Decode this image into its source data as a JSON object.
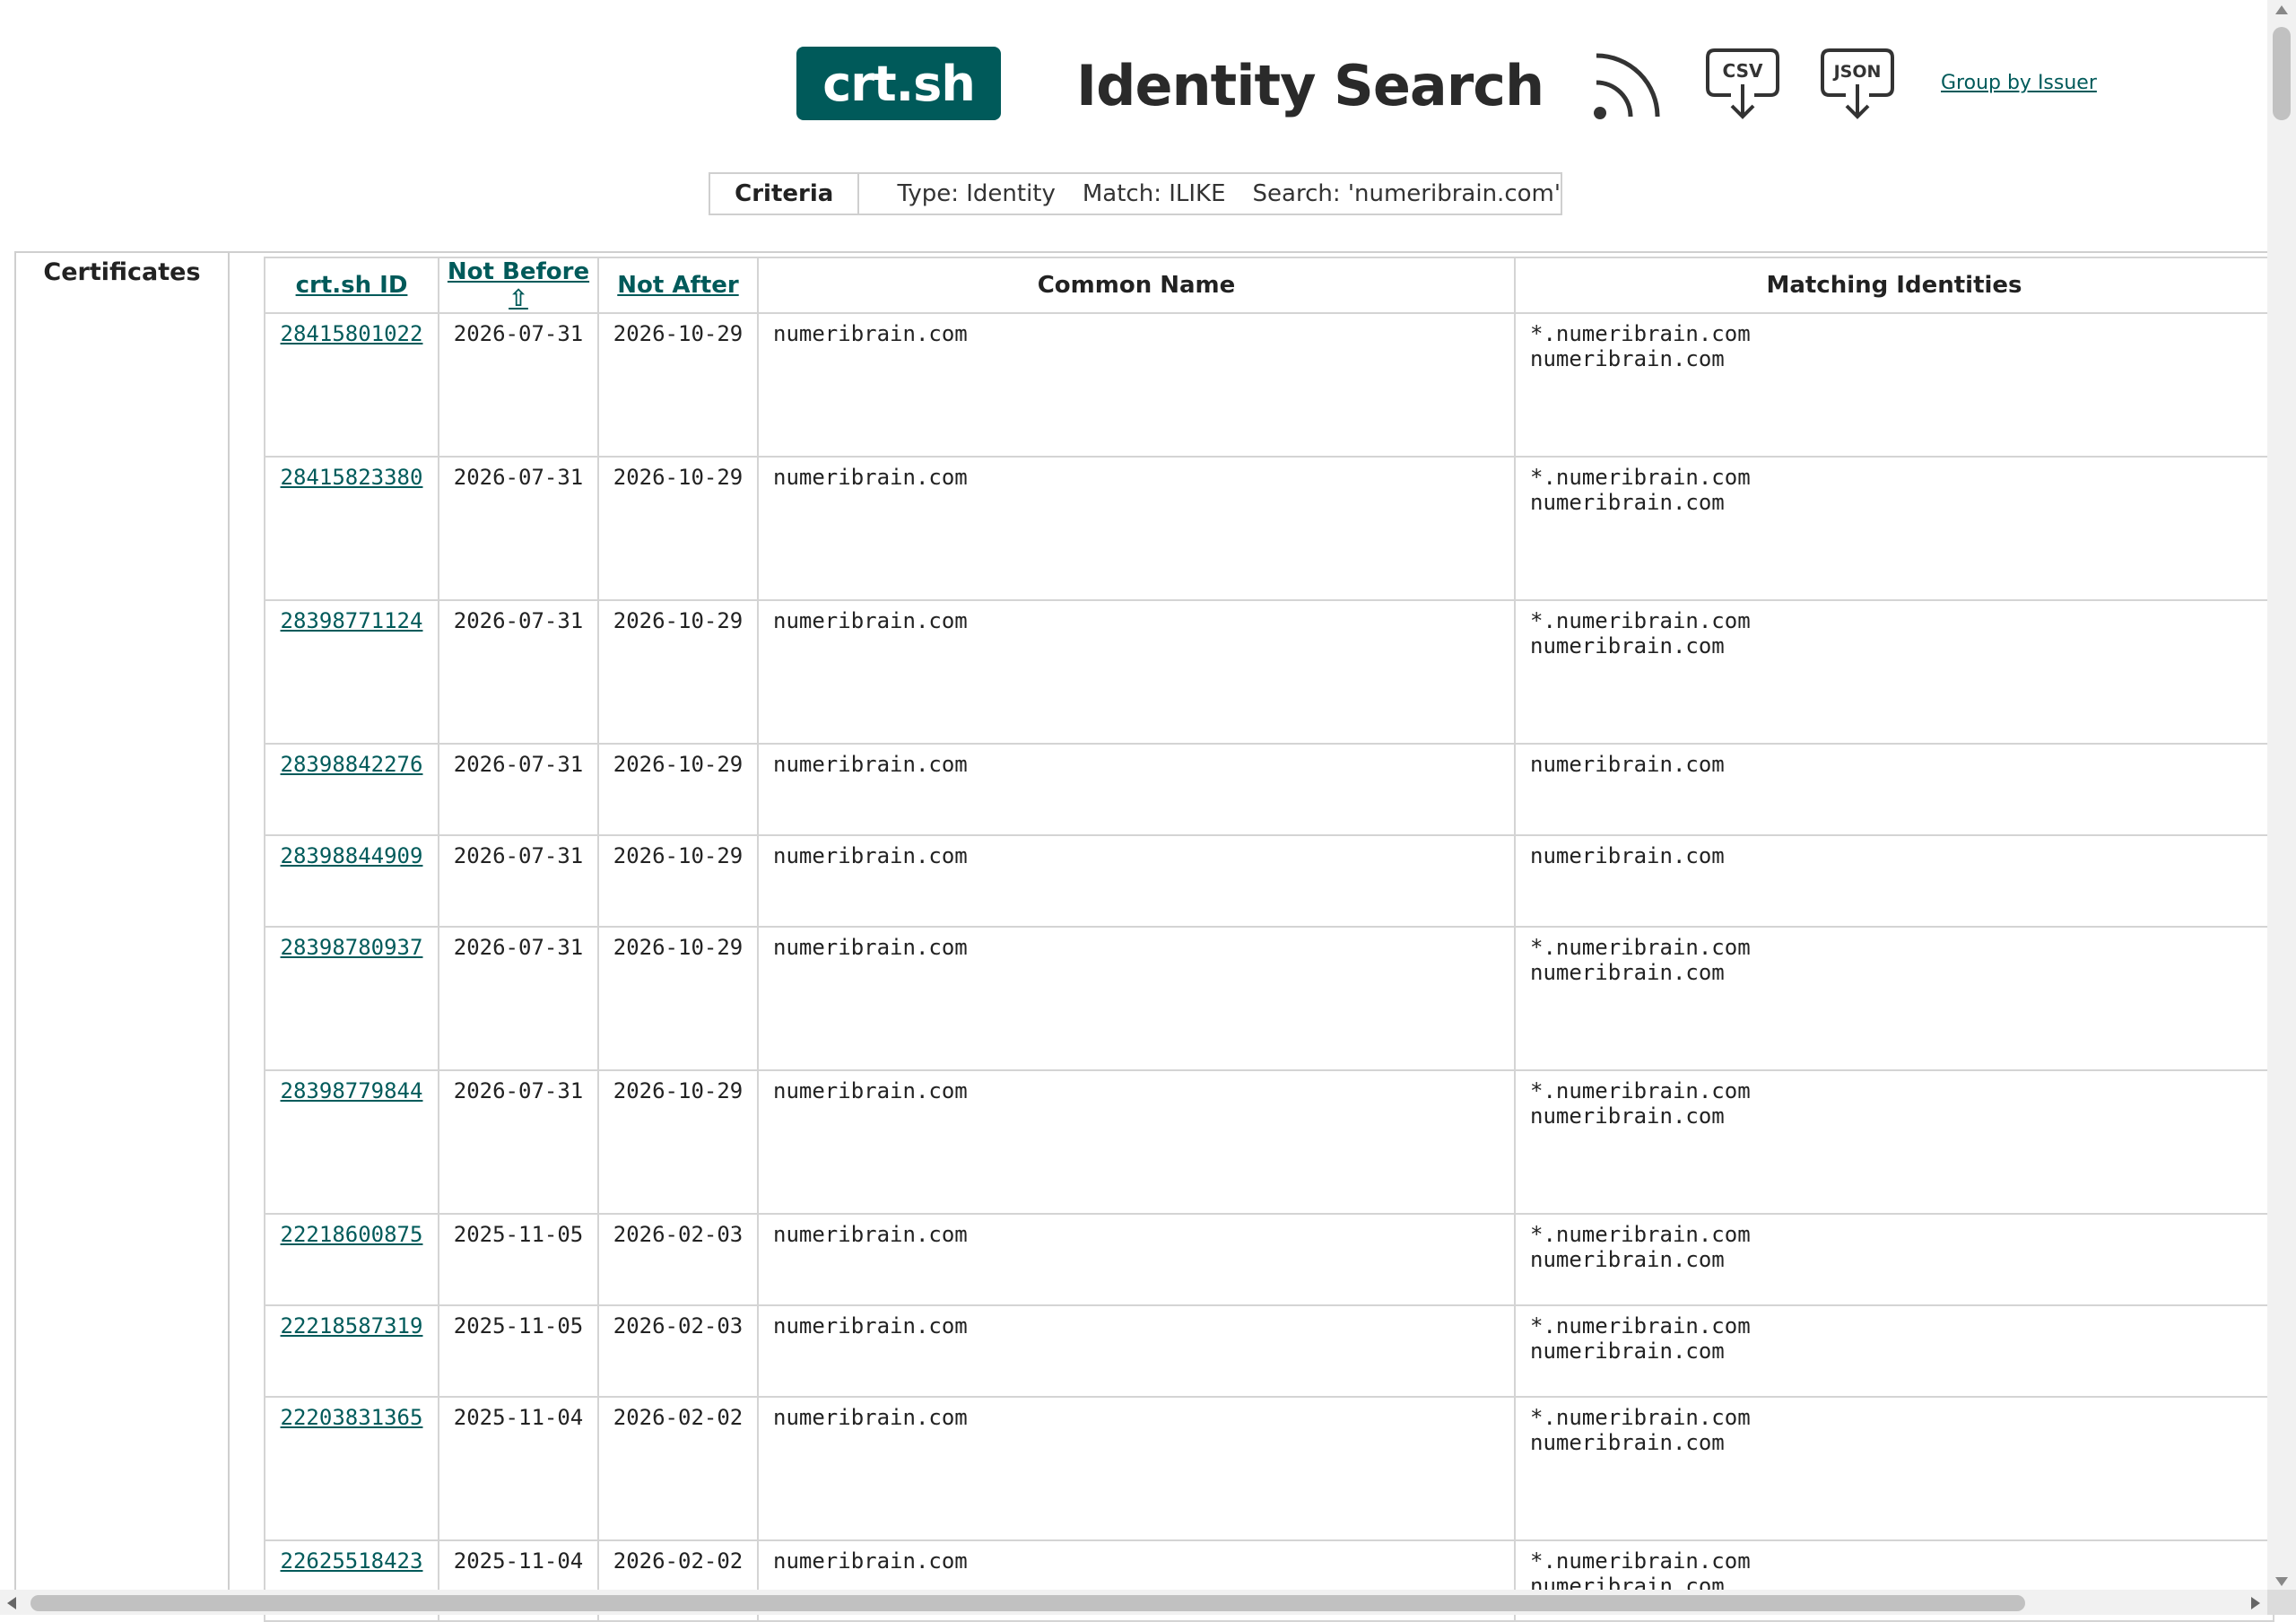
{
  "header": {
    "logo_text": "crt.sh",
    "title": "Identity Search",
    "icons": [
      "rss-icon",
      "csv-download-icon",
      "json-download-icon"
    ],
    "csv_label": "CSV",
    "json_label": "JSON",
    "group_link": "Group by Issuer"
  },
  "criteria": {
    "label": "Criteria",
    "type": "Type: Identity",
    "match": "Match: ILIKE",
    "search": "Search: 'numeribrain.com'"
  },
  "certificates": {
    "label": "Certificates",
    "columns": [
      "crt.sh ID",
      "Not Before ⇧",
      "Not After",
      "Common Name",
      "Matching Identities"
    ],
    "rows": [
      {
        "id": "28415801022",
        "not_before": "2026-07-31",
        "not_after": "2026-10-29",
        "common_name": "numeribrain.com",
        "identity_1": "*.numeribrain.com",
        "identity_2": "numeribrain.com"
      },
      {
        "id": "28415823380",
        "not_before": "2026-07-31",
        "not_after": "2026-10-29",
        "common_name": "numeribrain.com",
        "identity_1": "*.numeribrain.com",
        "identity_2": "numeribrain.com"
      },
      {
        "id": "28398771124",
        "not_before": "2026-07-31",
        "not_after": "2026-10-29",
        "common_name": "numeribrain.com",
        "identity_1": "*.numeribrain.com",
        "identity_2": "numeribrain.com"
      },
      {
        "id": "28398842276",
        "not_before": "2026-07-31",
        "not_after": "2026-10-29",
        "common_name": "numeribrain.com",
        "identity_1": "numeribrain.com",
        "identity_2": ""
      },
      {
        "id": "28398844909",
        "not_before": "2026-07-31",
        "not_after": "2026-10-29",
        "common_name": "numeribrain.com",
        "identity_1": "numeribrain.com",
        "identity_2": ""
      },
      {
        "id": "28398780937",
        "not_before": "2026-07-31",
        "not_after": "2026-10-29",
        "common_name": "numeribrain.com",
        "identity_1": "*.numeribrain.com",
        "identity_2": "numeribrain.com"
      },
      {
        "id": "28398779844",
        "not_before": "2026-07-31",
        "not_after": "2026-10-29",
        "common_name": "numeribrain.com",
        "identity_1": "*.numeribrain.com",
        "identity_2": "numeribrain.com"
      },
      {
        "id": "22218600875",
        "not_before": "2025-11-05",
        "not_after": "2026-02-03",
        "common_name": "numeribrain.com",
        "identity_1": "*.numeribrain.com",
        "identity_2": "numeribrain.com"
      },
      {
        "id": "22218587319",
        "not_before": "2025-11-05",
        "not_after": "2026-02-03",
        "common_name": "numeribrain.com",
        "identity_1": "*.numeribrain.com",
        "identity_2": "numeribrain.com"
      },
      {
        "id": "22203831365",
        "not_before": "2025-11-04",
        "not_after": "2026-02-02",
        "common_name": "numeribrain.com",
        "identity_1": "*.numeribrain.com",
        "identity_2": "numeribrain.com"
      },
      {
        "id": "22625518423",
        "not_before": "2025-11-04",
        "not_after": "2026-02-02",
        "common_name": "numeribrain.com",
        "identity_1": "*.numeribrain.com",
        "identity_2": "numeribrain.com"
      }
    ]
  },
  "colors": {
    "brand": "#005a5a",
    "border": "#d4d4d4",
    "text": "#222222"
  }
}
